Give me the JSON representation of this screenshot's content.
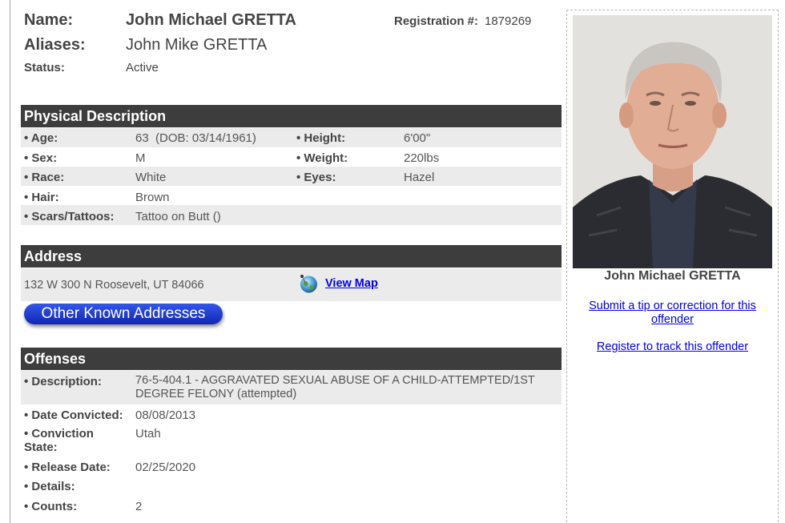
{
  "identity": {
    "name_label": "Name:",
    "name_value": "John Michael GRETTA",
    "aliases_label": "Aliases:",
    "aliases_value": "John Mike GRETTA",
    "status_label": "Status:",
    "status_value": "Active",
    "registration_label": "Registration #:",
    "registration_value": "1879269"
  },
  "physical": {
    "header": "Physical Description",
    "age_label": "• Age:",
    "age_value": "63  (DOB: 03/14/1961)",
    "height_label": "• Height:",
    "height_value": "6'00\"",
    "sex_label": "• Sex:",
    "sex_value": "M",
    "weight_label": "• Weight:",
    "weight_value": "220lbs",
    "race_label": "• Race:",
    "race_value": "White",
    "eyes_label": "• Eyes:",
    "eyes_value": "Hazel",
    "hair_label": "• Hair:",
    "hair_value": "Brown",
    "scars_label": "• Scars/Tattoos:",
    "scars_value": "Tattoo on Butt ()"
  },
  "address": {
    "header": "Address",
    "value": "132 W 300 N Roosevelt, UT 84066",
    "view_map": "View Map",
    "other_button": "Other Known Addresses"
  },
  "offenses": {
    "header": "Offenses",
    "description_label": "• Description:",
    "description_value": "76-5-404.1 - AGGRAVATED SEXUAL ABUSE OF A CHILD-ATTEMPTED/1ST DEGREE FELONY (attempted)",
    "date_convicted_label": "• Date Convicted:",
    "date_convicted_value": "08/08/2013",
    "conviction_state_label": "• Conviction State:",
    "conviction_state_value": "Utah",
    "release_date_label": "• Release Date:",
    "release_date_value": "02/25/2020",
    "details_label": "• Details:",
    "details_value": "",
    "counts_label": "• Counts:",
    "counts_value": "2"
  },
  "sidebar": {
    "name": "John Michael GRETTA",
    "tip_link": "Submit a tip or correction for this offender",
    "track_link": "Register to track this offender"
  },
  "icons": {
    "map": "globe-map-icon"
  }
}
